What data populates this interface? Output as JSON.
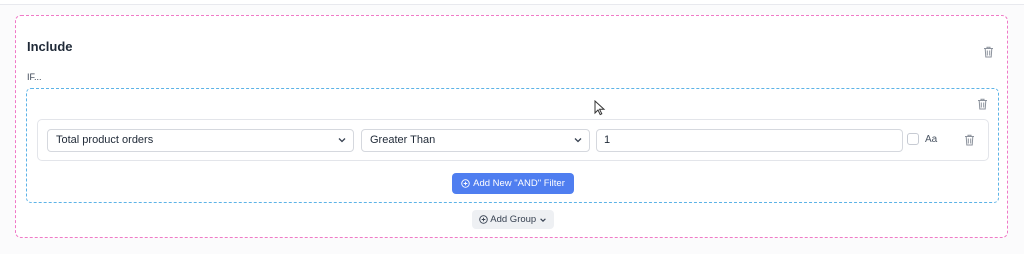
{
  "include_section": {
    "title": "Include",
    "if_label": "IF..."
  },
  "filter_row": {
    "field_value": "Total product orders",
    "operator_value": "Greater Than",
    "value_input": "1",
    "case_sensitive_label": "Aa",
    "case_sensitive_checked": false
  },
  "buttons": {
    "add_and_filter": "Add New \"AND\" Filter",
    "add_group": "Add Group"
  },
  "colors": {
    "include_border": "#f079c7",
    "group_border": "#5cb3e7",
    "primary_button": "#4f7ef0"
  }
}
